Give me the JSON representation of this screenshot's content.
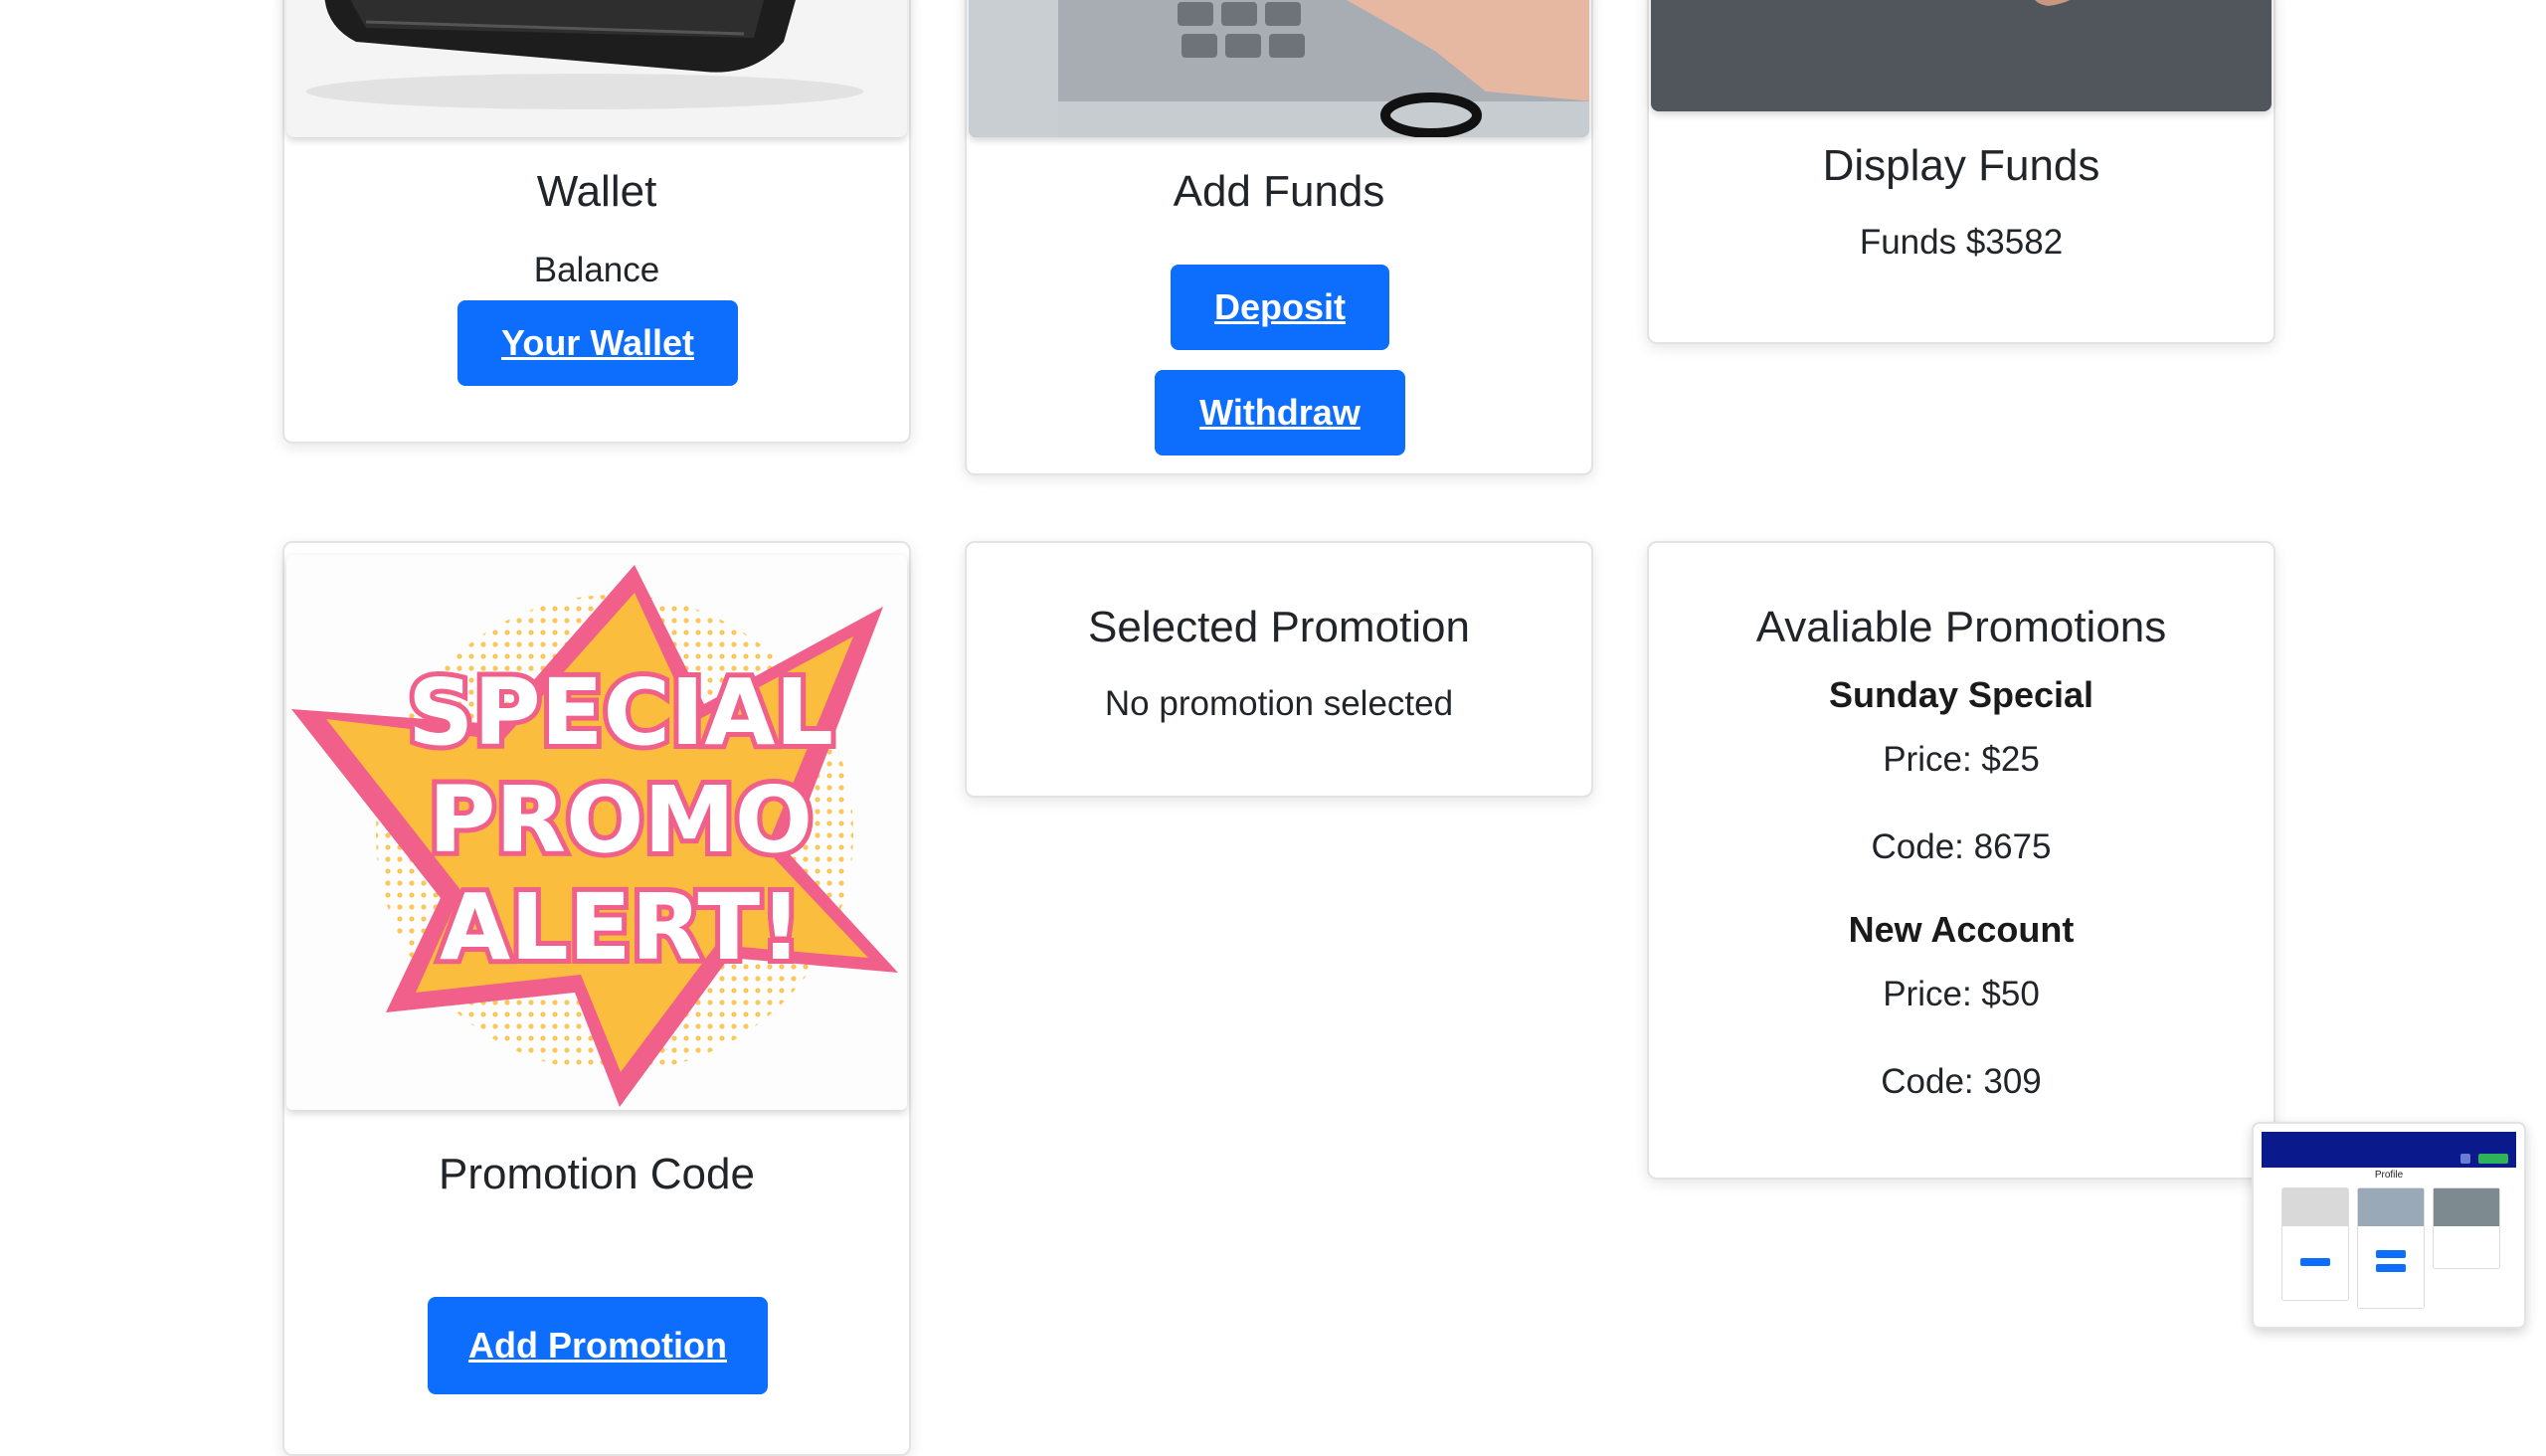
{
  "cards": {
    "wallet": {
      "title": "Wallet",
      "subtitle": "Balance",
      "button": "Your Wallet"
    },
    "add_funds": {
      "title": "Add Funds",
      "deposit": "Deposit",
      "withdraw": "Withdraw"
    },
    "display_funds": {
      "title": "Display Funds",
      "funds_text": "Funds $3582"
    },
    "promotion_code": {
      "title": "Promotion Code",
      "button": "Add Promotion",
      "image_text": [
        "SPECIAL",
        "PROMO",
        "ALERT!"
      ]
    },
    "selected_promotion": {
      "title": "Selected Promotion",
      "status": "No promotion selected"
    },
    "available_promotions": {
      "title": "Avaliable Promotions",
      "items": [
        {
          "name": "Sunday Special",
          "price": "Price: $25",
          "code": "Code: 8675"
        },
        {
          "name": "New Account",
          "price": "Price: $50",
          "code": "Code: 309"
        }
      ]
    }
  },
  "thumbnail": {
    "heading": "Profile"
  },
  "colors": {
    "primary_button": "#0d6efd",
    "promo_pink": "#f0608a",
    "promo_yellow": "#fbbd3e",
    "thumbnail_nav": "#0a1a8c"
  }
}
